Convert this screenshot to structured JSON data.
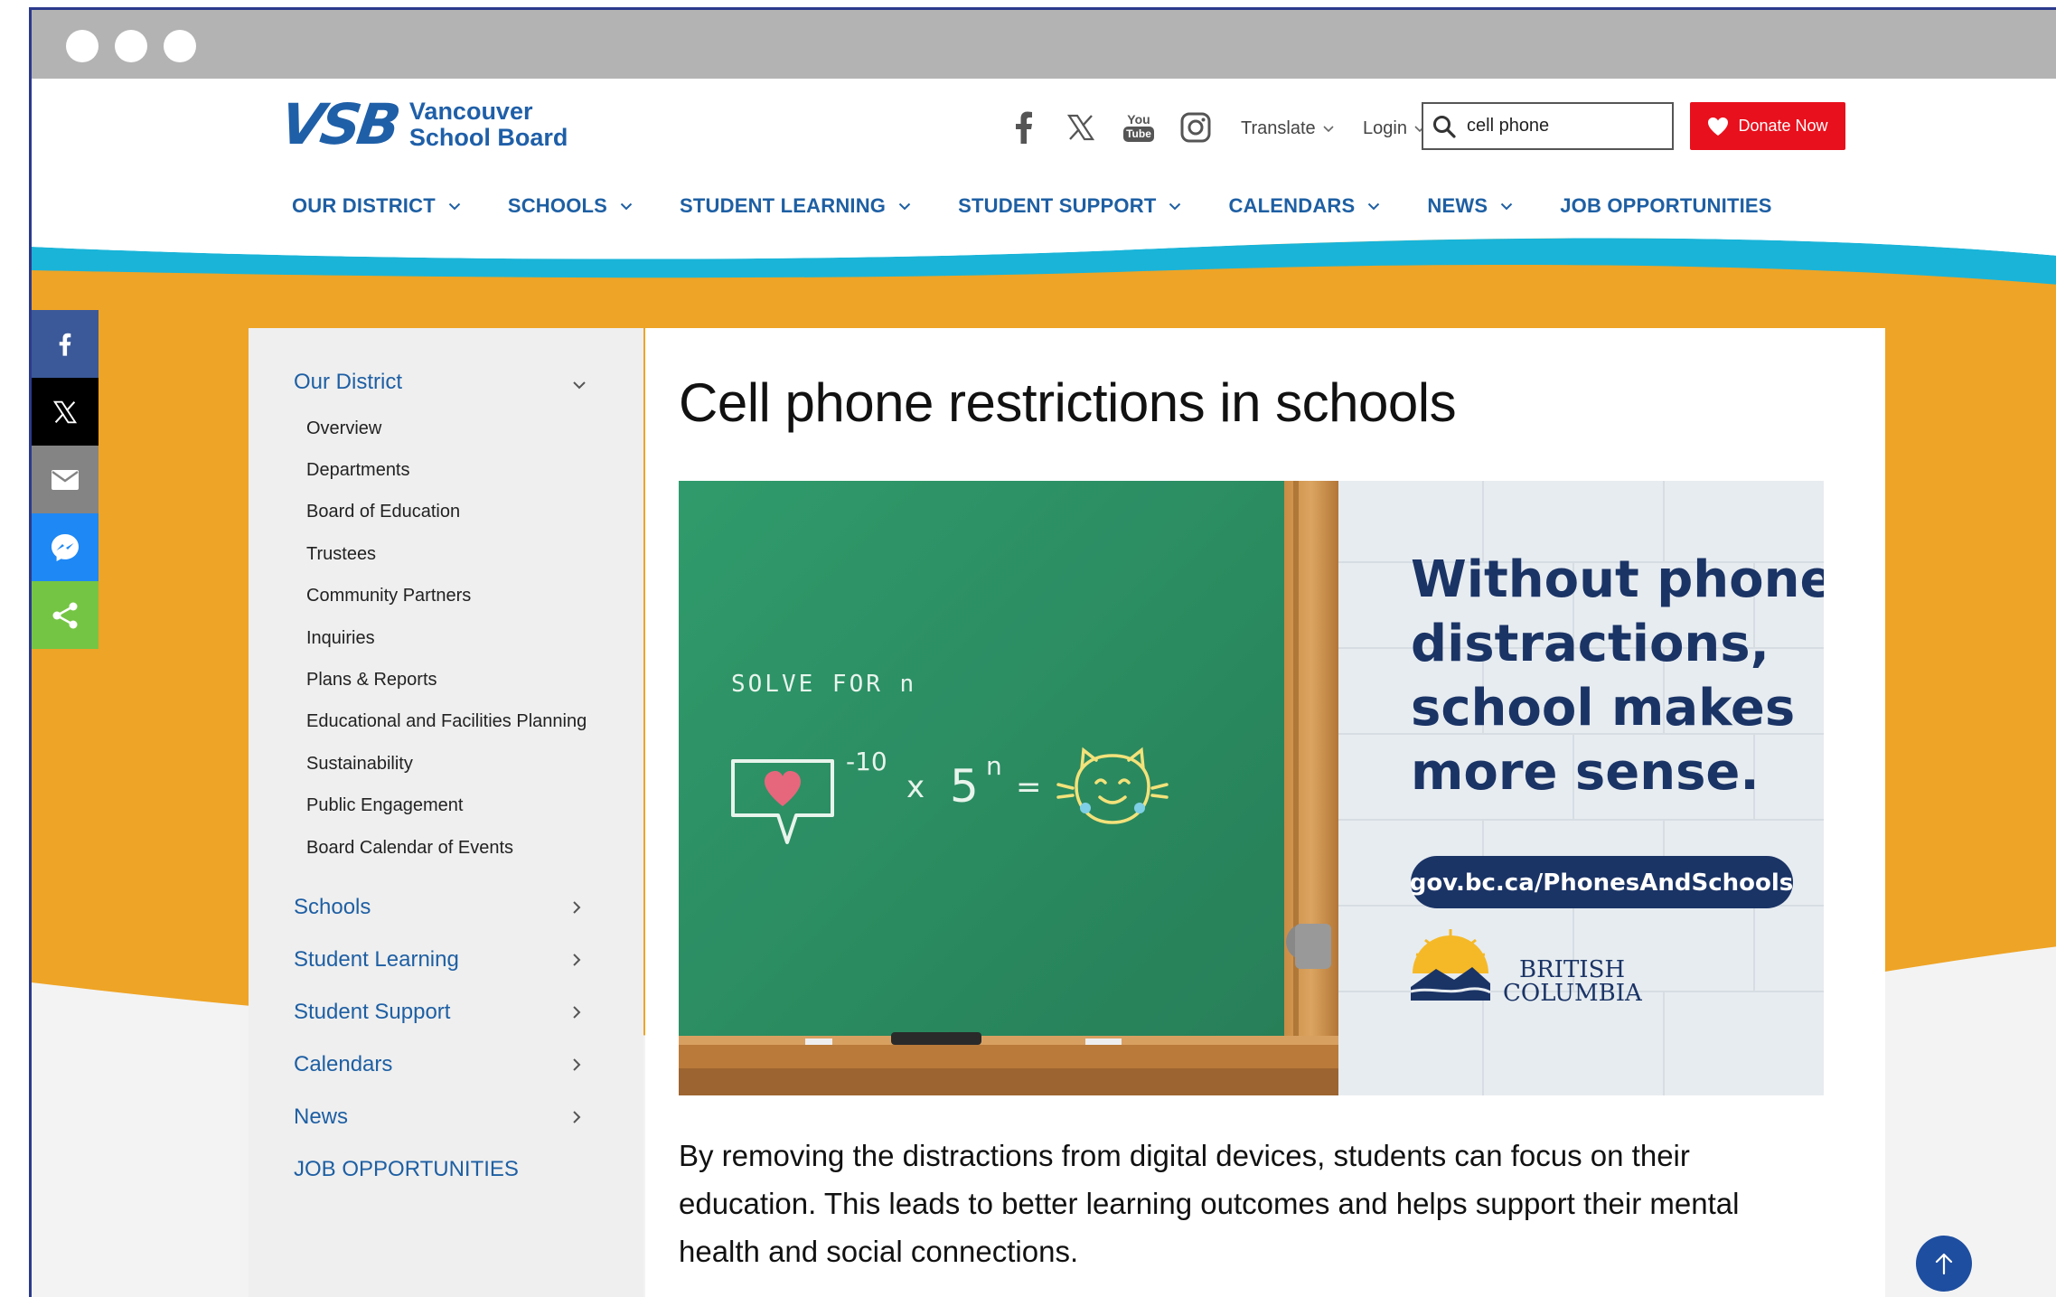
{
  "header": {
    "logo_mark": "VSB",
    "logo_line1": "Vancouver",
    "logo_line2": "School Board",
    "social_icons": [
      "facebook-icon",
      "x-icon",
      "youtube-icon",
      "instagram-icon"
    ],
    "youtube_text_top": "You",
    "youtube_text_bottom": "Tube",
    "translate_label": "Translate",
    "login_label": "Login",
    "search_value": "cell phone",
    "donate_label": "Donate Now"
  },
  "nav": {
    "items": [
      {
        "label": "OUR DISTRICT",
        "dropdown": true
      },
      {
        "label": "SCHOOLS",
        "dropdown": true
      },
      {
        "label": "STUDENT LEARNING",
        "dropdown": true
      },
      {
        "label": "STUDENT SUPPORT",
        "dropdown": true
      },
      {
        "label": "CALENDARS",
        "dropdown": true
      },
      {
        "label": "NEWS",
        "dropdown": true
      },
      {
        "label": "JOB OPPORTUNITIES",
        "dropdown": false
      }
    ]
  },
  "share": {
    "buttons": [
      {
        "icon": "facebook-icon",
        "color": "#3b5998"
      },
      {
        "icon": "x-icon",
        "color": "#000000"
      },
      {
        "icon": "email-icon",
        "color": "#848484"
      },
      {
        "icon": "messenger-icon",
        "color": "#1e88f5"
      },
      {
        "icon": "share-icon",
        "color": "#75c544"
      }
    ]
  },
  "sidebar": {
    "open_section": "Our District",
    "children": [
      "Overview",
      "Departments",
      "Board of Education",
      "Trustees",
      "Community Partners",
      "Inquiries",
      "Plans & Reports",
      "Educational and Facilities Planning",
      "Sustainability",
      "Public Engagement",
      "Board Calendar of Events"
    ],
    "sections": [
      "Schools",
      "Student Learning",
      "Student Support",
      "Calendars",
      "News"
    ],
    "job_link": "JOB OPPORTUNITIES"
  },
  "content": {
    "title": "Cell phone restrictions in schools",
    "hero": {
      "chalk_line1": "SOLVE FOR n",
      "chalk_exp": "-10",
      "chalk_x": "x",
      "chalk_5": "5",
      "chalk_n": "n",
      "chalk_eq": "=",
      "headline_1": "Without phone",
      "headline_2": "distractions,",
      "headline_3": "school makes",
      "headline_4": "more sense.",
      "url": "gov.bc.ca/PhonesAndSchools",
      "bc_line1": "BRITISH",
      "bc_line2": "COLUMBIA"
    },
    "body": "By removing the distractions from digital devices, students can focus on their education. This leads to better learning outcomes and helps support their mental health and social connections."
  },
  "colors": {
    "brand_blue": "#1e5fa3",
    "accent_orange": "#eea426",
    "wave_cyan": "#1ab4d8",
    "donate_red": "#e8101c",
    "chalkboard_green": "#2e9468",
    "navy_text": "#1b3466"
  }
}
